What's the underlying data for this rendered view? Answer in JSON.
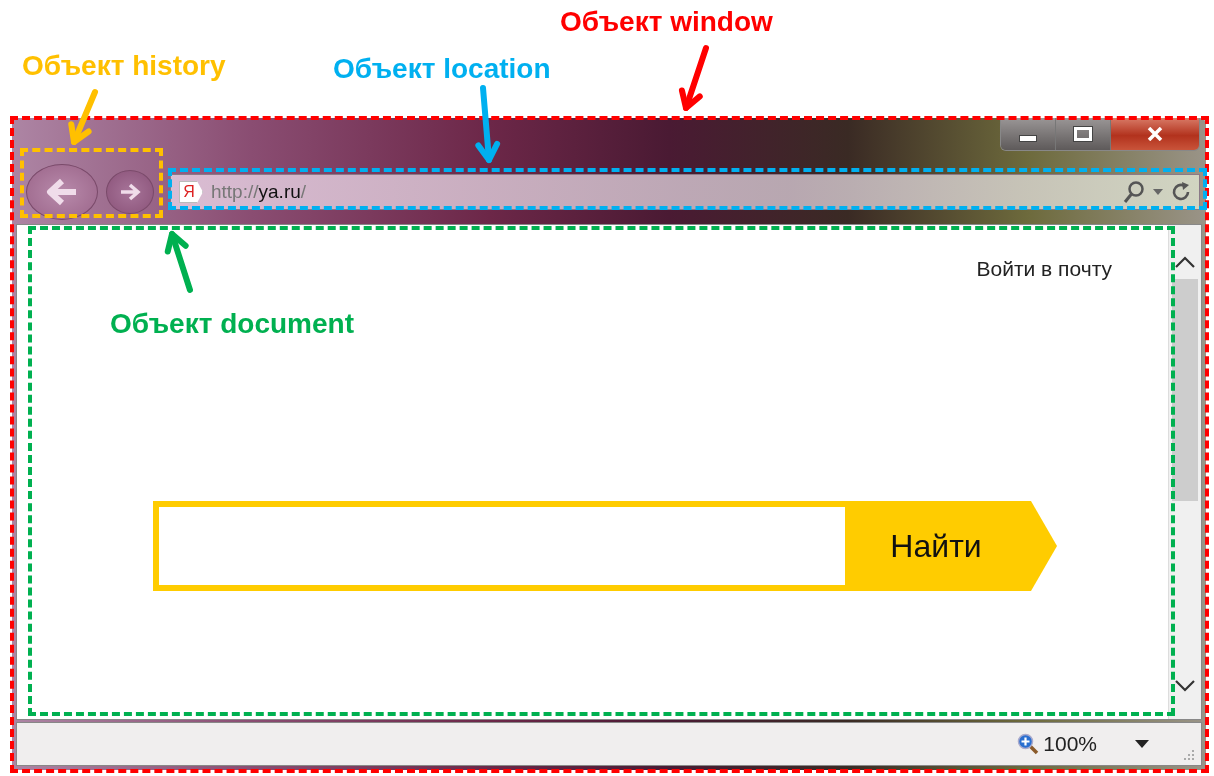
{
  "annotations": [
    {
      "label": "Объект window",
      "color": "#ff0000"
    },
    {
      "label": "Объект history",
      "color": "#ffc000"
    },
    {
      "label": "Объект location",
      "color": "#00b0f0"
    },
    {
      "label": "Объект document",
      "color": "#00b050"
    }
  ],
  "browser": {
    "favicon": "Я",
    "url": {
      "scheme": "http://",
      "host": "ya.ru",
      "path": "/"
    },
    "page": {
      "login_link": "Войти в почту",
      "search_button": "Найти"
    },
    "status_bar": {
      "zoom": "100%"
    }
  }
}
